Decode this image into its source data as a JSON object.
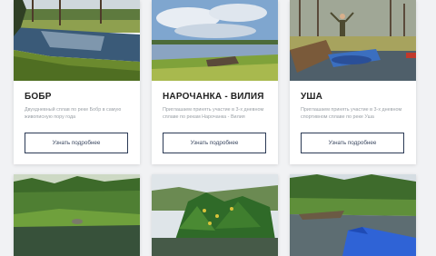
{
  "tours": [
    {
      "title": "БОБР",
      "description": "Двухдневный сплав по реке Бобр в самую живописную пору года",
      "button_label": "Узнать подробнее",
      "image": "river-meadow-photo"
    },
    {
      "title": "НАРОЧАНКА - ВИЛИЯ",
      "description": "Приглашаем принять участие в 3-х дневном сплаве по рекам Нарочанка - Вилия",
      "button_label": "Узнать подробнее",
      "image": "lake-boat-photo"
    },
    {
      "title": "УША",
      "description": "Приглашаем принять участие в 3-х дневном спортивном сплаве по реке Уша",
      "button_label": "Узнать подробнее",
      "image": "kayaker-river-photo"
    },
    {
      "image": "green-river-photo"
    },
    {
      "image": "iris-reeds-photo"
    },
    {
      "image": "kayak-bow-photo"
    }
  ]
}
